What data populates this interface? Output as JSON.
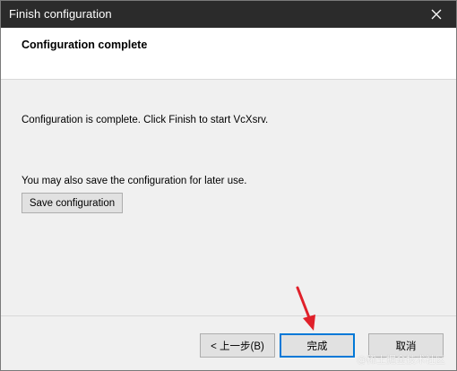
{
  "window": {
    "title": "Finish configuration"
  },
  "header": {
    "heading": "Configuration complete"
  },
  "content": {
    "message": "Configuration is complete. Click Finish to start VcXsrv.",
    "save_hint": "You may also save the configuration for later use.",
    "save_button": "Save configuration"
  },
  "footer": {
    "back_button": "< 上一步(B)",
    "finish_button": "完成",
    "cancel_button": "取消"
  },
  "watermark": "@稀土掘金技术社区",
  "colors": {
    "titlebar": "#2b2b2b",
    "dialog_bg": "#f0f0f0",
    "header_bg": "#ffffff",
    "default_button_border": "#0078d7",
    "annotation_arrow": "#e0202a"
  },
  "icons": {
    "close": "close-icon",
    "annotation": "red-arrow-icon"
  }
}
